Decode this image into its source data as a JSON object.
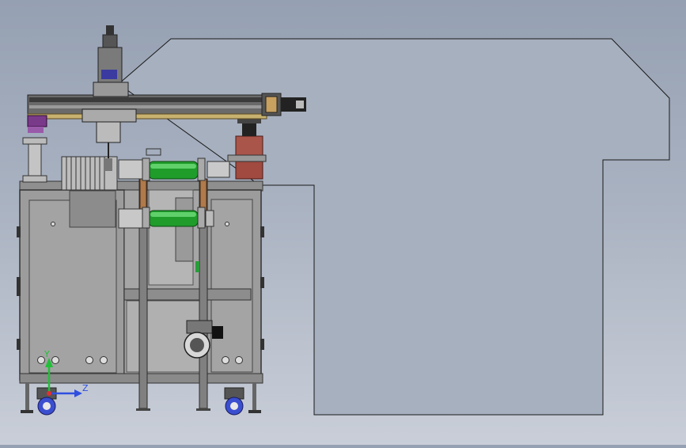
{
  "viewport": {
    "background_top": "#95a0b2",
    "background_bottom": "#c9ced8"
  },
  "triad": {
    "y_label": "Y",
    "z_label": "Z",
    "y_color": "#22c03a",
    "z_color": "#2f4fe0",
    "x_color": "#e03030"
  },
  "colors": {
    "frame_gray": "#9a9a9a",
    "frame_dark": "#3c3c3c",
    "roller_green": "#1f9c2a",
    "motor_red": "#a9554a",
    "gantry_gold": "#c8b270",
    "caster_blue": "#3a4fd0",
    "purple_block": "#7a3a8a"
  }
}
